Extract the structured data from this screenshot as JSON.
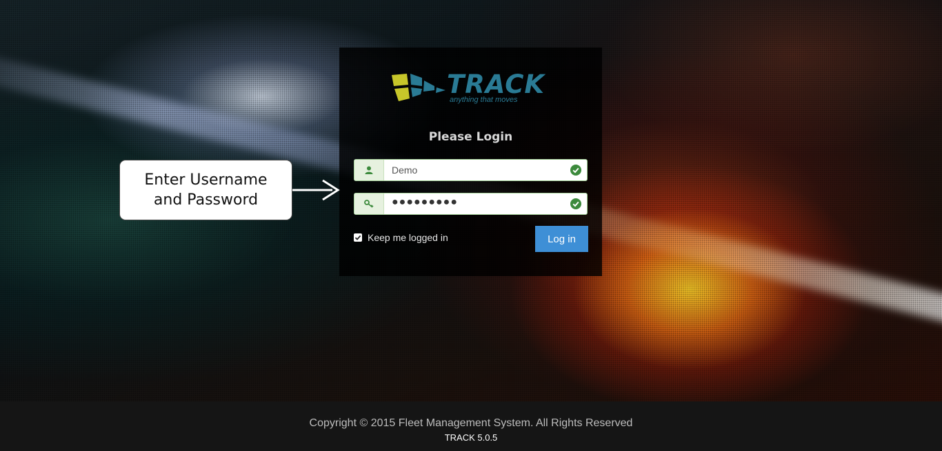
{
  "brand": {
    "name": "TRACK",
    "tagline": "anything that moves"
  },
  "login": {
    "title": "Please Login",
    "username": {
      "value": "Demo",
      "icon": "user-icon",
      "status_icon": "check-circle-icon"
    },
    "password": {
      "value": "●●●●●●●●●",
      "icon": "key-icon",
      "status_icon": "check-circle-icon"
    },
    "remember": {
      "label": "Keep me logged in",
      "checked": true
    },
    "submit_label": "Log in"
  },
  "callout": {
    "line1": "Enter Username",
    "line2": "and Password"
  },
  "footer": {
    "copyright": "Copyright © 2015 Fleet Management System. All Rights Reserved",
    "version": "TRACK 5.0.5"
  },
  "colors": {
    "accent": "#3e8fd6",
    "brand_blue": "#2a7b95",
    "brand_yellow": "#c7c62a",
    "valid_green": "#3c8a3c"
  }
}
